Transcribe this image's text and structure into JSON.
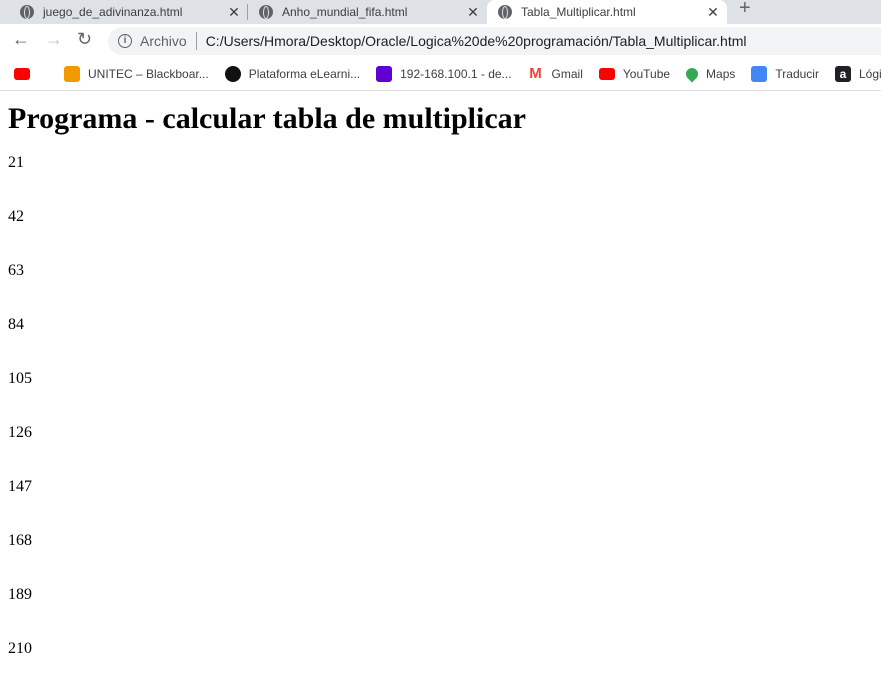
{
  "tabs": [
    {
      "label": "juego_de_adivinanza.html",
      "active": false
    },
    {
      "label": "Anho_mundial_fifa.html",
      "active": false
    },
    {
      "label": "Tabla_Multiplicar.html",
      "active": true
    }
  ],
  "address": {
    "scheme": "Archivo",
    "url": "C:/Users/Hmora/Desktop/Oracle/Logica%20de%20programación/Tabla_Multiplicar.html"
  },
  "bookmarks": [
    {
      "label": "",
      "icon": "youtube-icon",
      "color": "#ff0000"
    },
    {
      "label": "UNITEC – Blackboar...",
      "icon": "pencil-icon",
      "color": "#f29900"
    },
    {
      "label": "Plataforma eLearni...",
      "icon": "globe-icon",
      "color": "#111111"
    },
    {
      "label": "192-168.100.1 - de...",
      "icon": "yahoo-icon",
      "color": "#6001d2"
    },
    {
      "label": "Gmail",
      "icon": "gmail-icon",
      "color": "#ea4335"
    },
    {
      "label": "YouTube",
      "icon": "youtube-icon",
      "color": "#ff0000"
    },
    {
      "label": "Maps",
      "icon": "maps-icon",
      "color": "#34a853"
    },
    {
      "label": "Traducir",
      "icon": "translate-icon",
      "color": "#4285f4"
    },
    {
      "label": "Lógica",
      "icon": "a-icon",
      "color": "#202124"
    }
  ],
  "page": {
    "title": "Programa - calcular tabla de multiplicar",
    "results": [
      "21",
      "42",
      "63",
      "84",
      "105",
      "126",
      "147",
      "168",
      "189",
      "210"
    ]
  }
}
